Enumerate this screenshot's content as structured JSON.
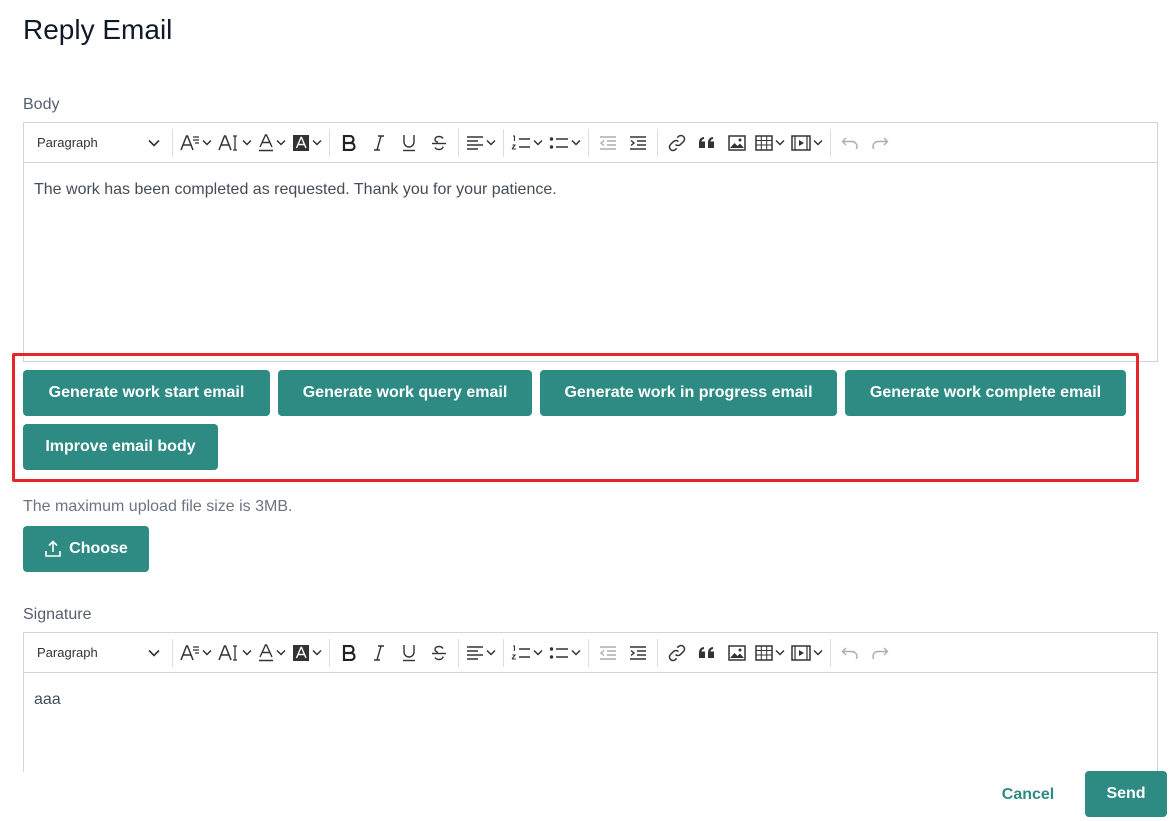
{
  "page": {
    "title": "Reply Email"
  },
  "body_field": {
    "label": "Body",
    "toolbar": {
      "block_format": "Paragraph"
    },
    "content": "The work has been completed as requested. Thank you for your patience."
  },
  "ai_actions": {
    "generate_start": "Generate work start email",
    "generate_query": "Generate work query email",
    "generate_progress": "Generate work in progress email",
    "generate_complete": "Generate work complete email",
    "improve_body": "Improve email body"
  },
  "upload": {
    "note": "The maximum upload file size is 3MB.",
    "choose_label": "Choose"
  },
  "signature_field": {
    "label": "Signature",
    "toolbar": {
      "block_format": "Paragraph"
    },
    "content": "aaa"
  },
  "footer": {
    "cancel_label": "Cancel",
    "send_label": "Send"
  },
  "colors": {
    "accent": "#2e8b84",
    "highlight": "#e5252a"
  }
}
